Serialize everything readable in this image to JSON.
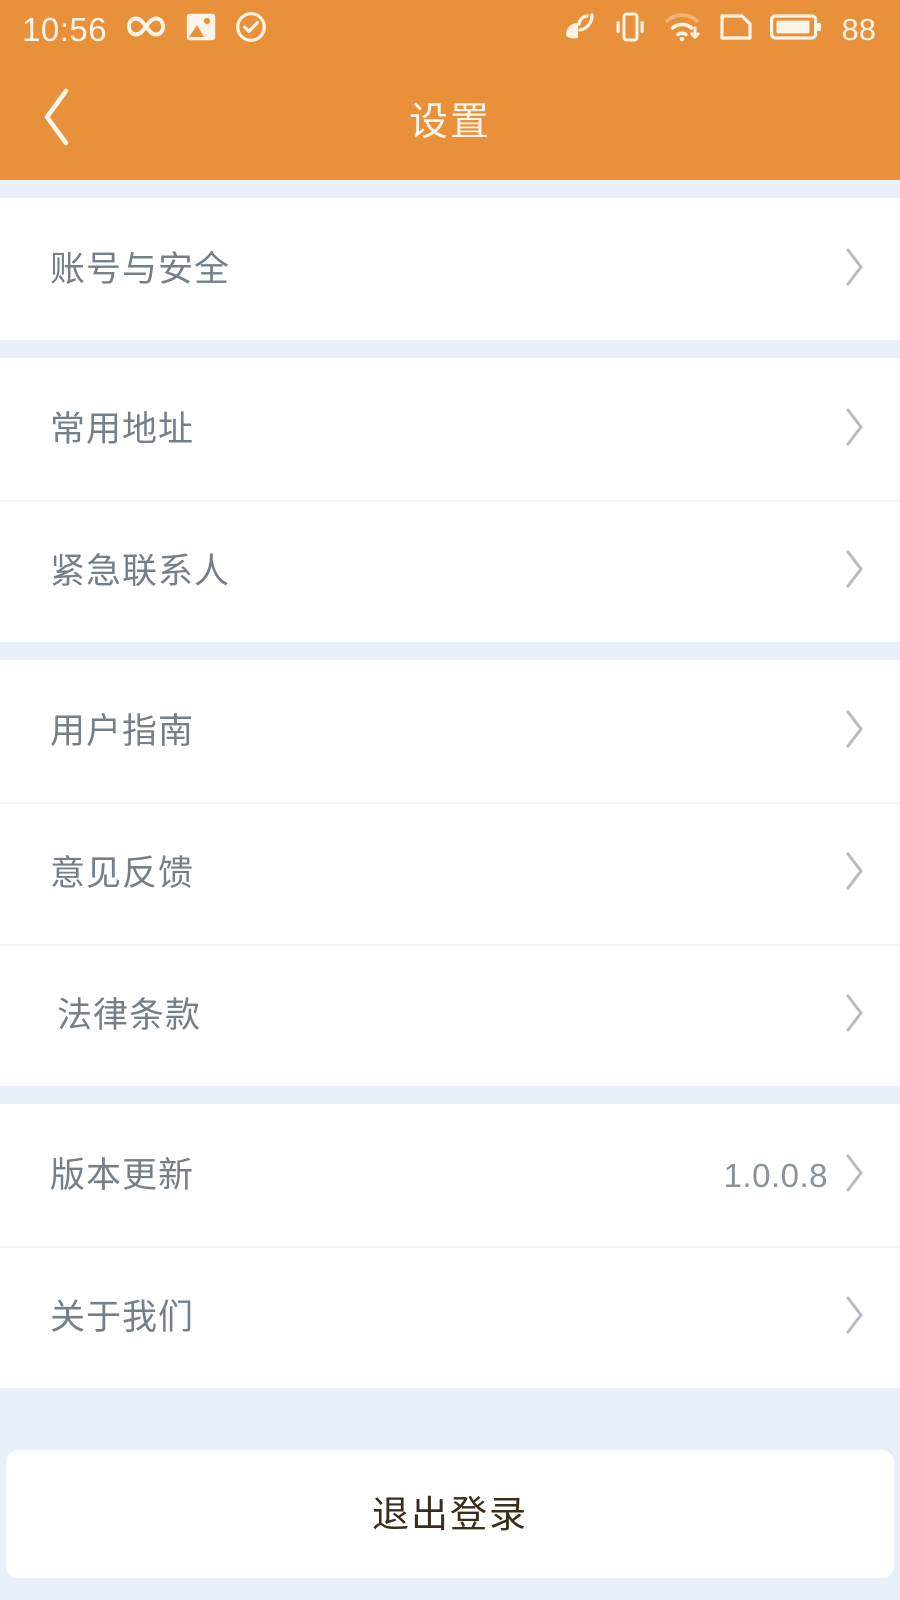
{
  "theme": {
    "accent": "#e8913a",
    "page_bg": "#e9f0fa",
    "card_bg": "#ffffff",
    "label_color": "#757f8a",
    "value_color": "#8a929b",
    "logout_color": "#3b2d1c"
  },
  "status_bar": {
    "time": "10:56",
    "battery_level": "88",
    "left_icons": [
      "infinity-icon",
      "image-icon",
      "check-circle-icon"
    ],
    "right_icons": [
      "location-icon",
      "vibrate-icon",
      "wifi-download-icon",
      "sim-card-icon",
      "battery-icon"
    ]
  },
  "app_bar": {
    "back_icon": "chevron-left-icon",
    "title": "设置"
  },
  "groups": [
    {
      "items": [
        {
          "label": "账号与安全",
          "value": "",
          "indent": false,
          "chevron": "chevron-right-icon"
        }
      ]
    },
    {
      "items": [
        {
          "label": "常用地址",
          "value": "",
          "indent": false,
          "chevron": "chevron-right-icon"
        },
        {
          "label": "紧急联系人",
          "value": "",
          "indent": false,
          "chevron": "chevron-right-icon"
        }
      ]
    },
    {
      "items": [
        {
          "label": "用户指南",
          "value": "",
          "indent": false,
          "chevron": "chevron-right-icon"
        },
        {
          "label": "意见反馈",
          "value": "",
          "indent": false,
          "chevron": "chevron-right-icon"
        },
        {
          "label": "法律条款",
          "value": "",
          "indent": true,
          "chevron": "chevron-right-icon"
        }
      ]
    },
    {
      "items": [
        {
          "label": "版本更新",
          "value": "1.0.0.8",
          "indent": false,
          "chevron": "chevron-right-icon"
        },
        {
          "label": "关于我们",
          "value": "",
          "indent": false,
          "chevron": "chevron-right-icon"
        }
      ]
    }
  ],
  "logout": {
    "label": "退出登录"
  }
}
